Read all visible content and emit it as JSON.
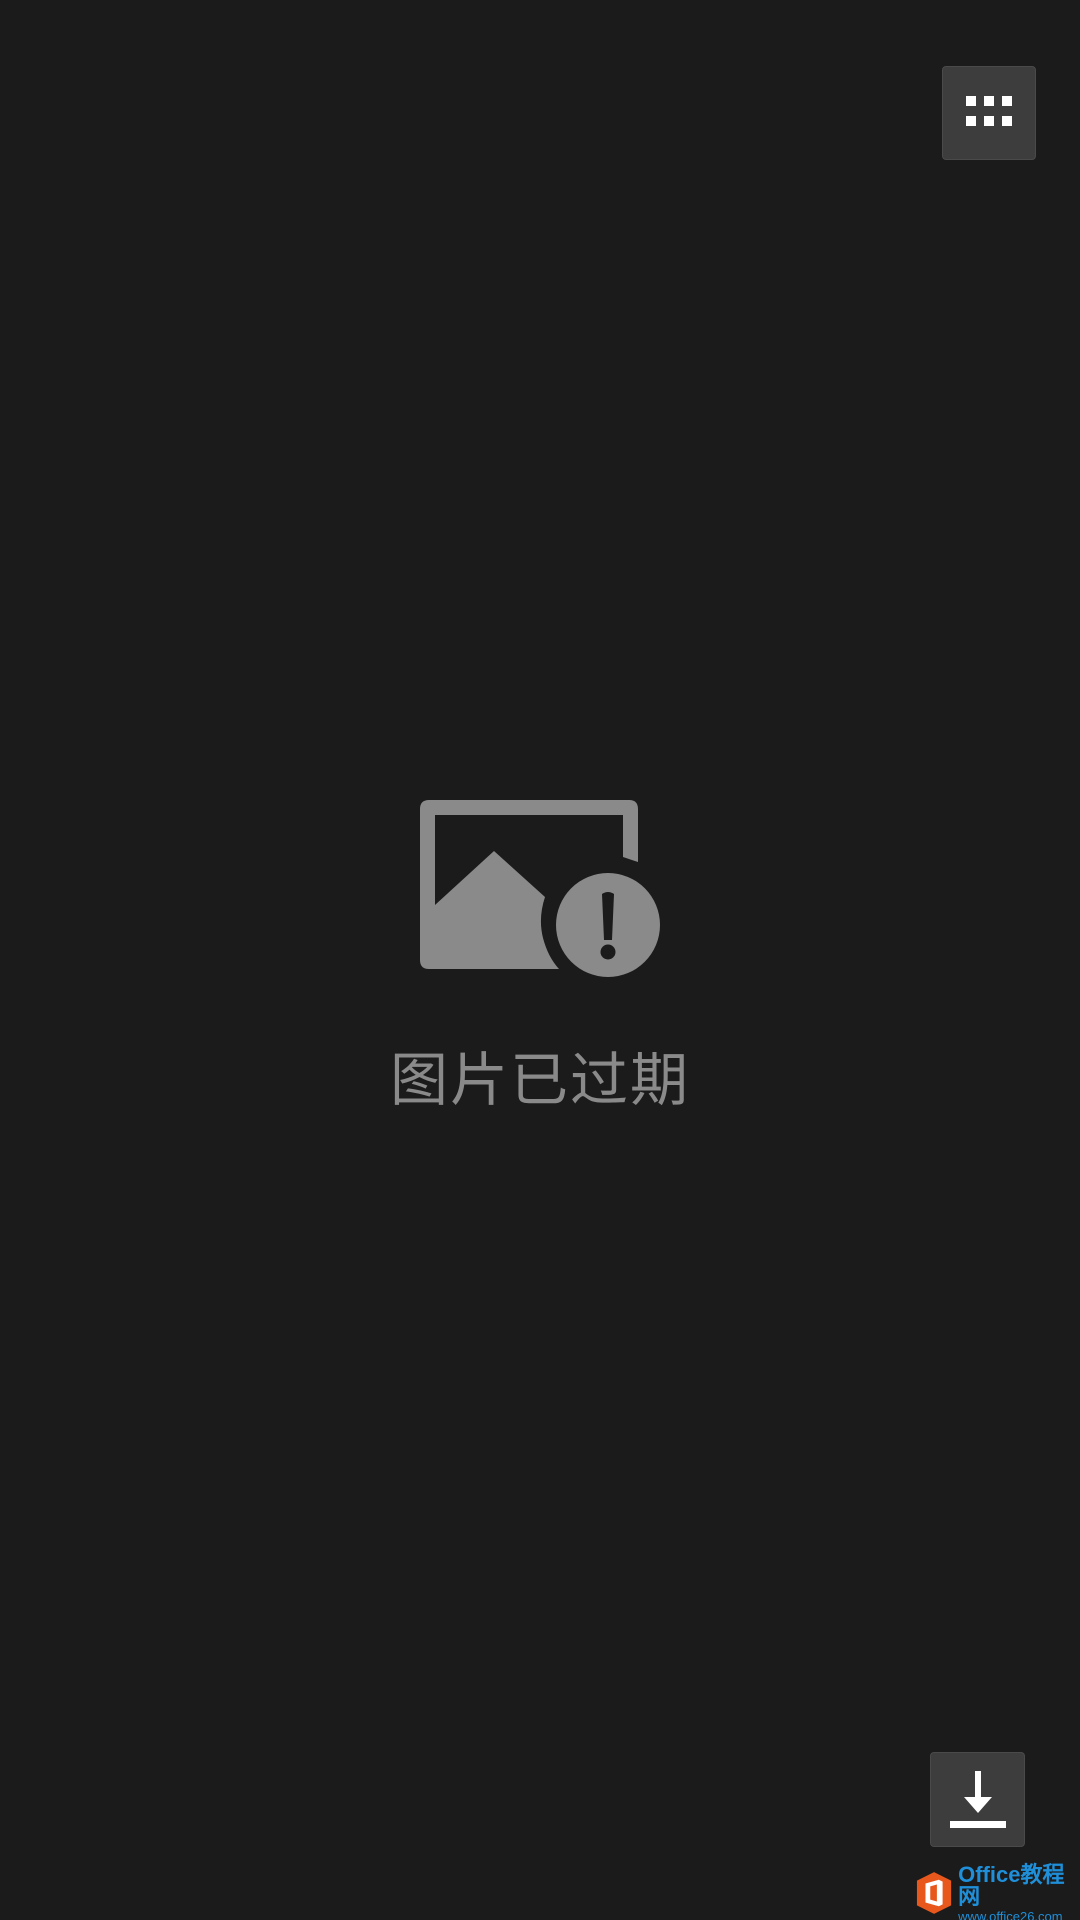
{
  "viewer": {
    "grid_icon": "grid-icon",
    "download_icon": "download-icon",
    "expired_icon": "image-expired-icon",
    "expired_message": "图片已过期"
  },
  "watermark": {
    "logo_icon": "office-logo-icon",
    "title": "Office教程网",
    "url": "www.office26.com"
  },
  "colors": {
    "background": "#1b1b1b",
    "button_bg": "#3d3d3d",
    "icon_gray": "#8a8a8a",
    "watermark_blue": "#1e8fd8",
    "office_orange": "#e8581c"
  }
}
